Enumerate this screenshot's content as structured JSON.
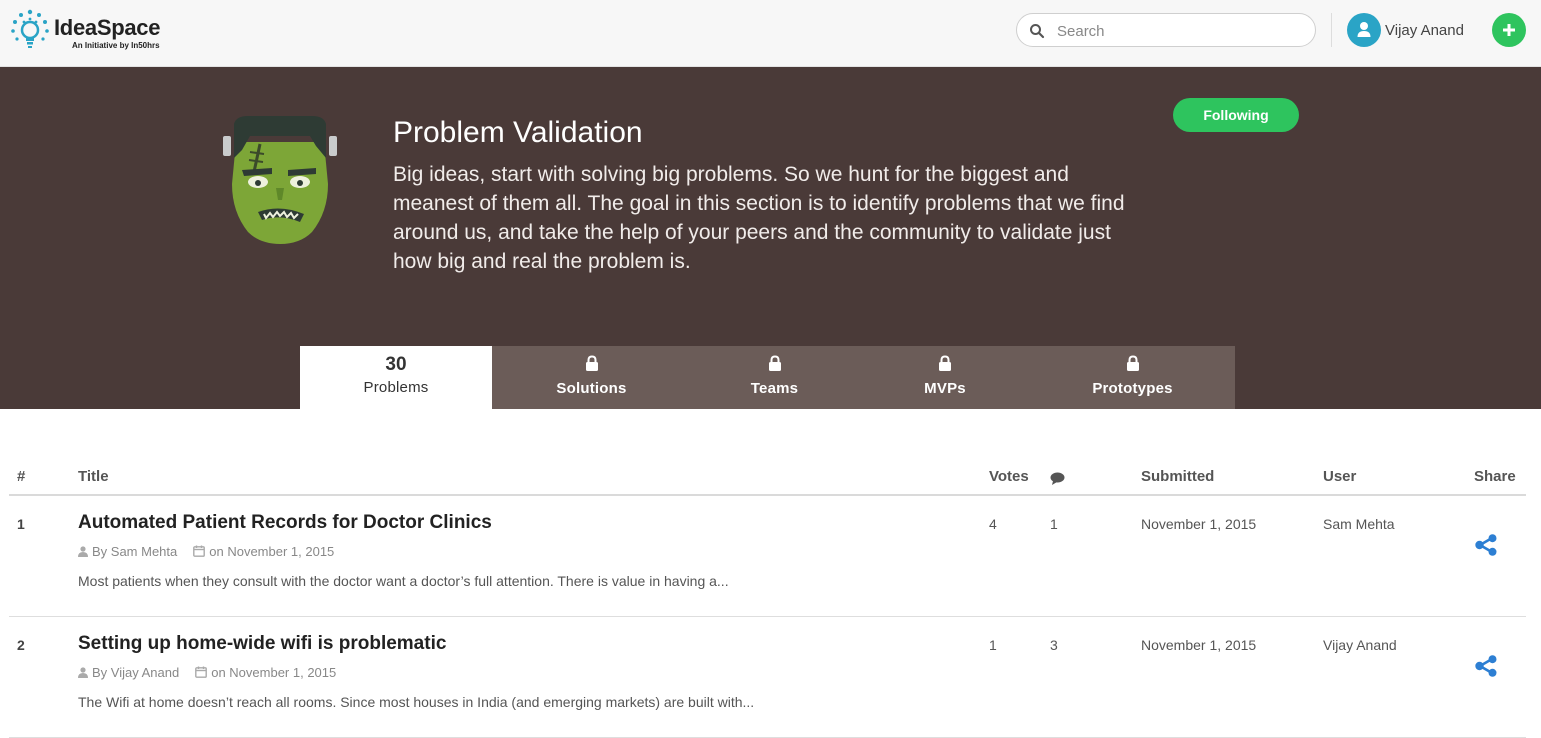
{
  "header": {
    "logo_name": "IdeaSpace",
    "logo_tagline": "An Initiative by In50hrs",
    "search_placeholder": "Search",
    "user_name": "Vijay Anand",
    "add_icon": "plus-icon"
  },
  "hero": {
    "title": "Problem Validation",
    "description": "Big ideas, start with solving big problems. So we hunt for the biggest and meanest of them all. The goal in this section is to identify problems that we find around us, and take the help of your peers and the community to validate just how big and real the problem is.",
    "follow_label": "Following",
    "mascot": "frankenstein-mascot"
  },
  "tabs": [
    {
      "count": "30",
      "label": "Problems",
      "active": true
    },
    {
      "label": "Solutions",
      "locked": true
    },
    {
      "label": "Teams",
      "locked": true
    },
    {
      "label": "MVPs",
      "locked": true
    },
    {
      "label": "Prototypes",
      "locked": true
    }
  ],
  "table": {
    "headers": {
      "num": "#",
      "title": "Title",
      "votes": "Votes",
      "comments_icon": "comment-icon",
      "submitted": "Submitted",
      "user": "User",
      "share": "Share"
    },
    "rows": [
      {
        "num": "1",
        "title": "Automated Patient Records for Doctor Clinics",
        "by": "By Sam Mehta",
        "on": "on November 1, 2015",
        "excerpt": "Most patients when they consult with the doctor want a doctor’s full attention. There is value in having a...",
        "votes": "4",
        "comments": "1",
        "submitted": "November 1, 2015",
        "user": "Sam Mehta"
      },
      {
        "num": "2",
        "title": "Setting up home-wide wifi is problematic",
        "by": "By Vijay Anand",
        "on": "on November 1, 2015",
        "excerpt": "The Wifi at home doesn’t reach all rooms. Since most houses in India (and emerging markets) are built with...",
        "votes": "1",
        "comments": "3",
        "submitted": "November 1, 2015",
        "user": "Vijay Anand"
      }
    ]
  },
  "colors": {
    "hero_bg": "#4a3a38",
    "tab_bar_bg": "#6b5c58",
    "accent_green": "#2ec45e",
    "avatar_blue": "#2aa4c6",
    "share_blue": "#2d7fd3"
  }
}
